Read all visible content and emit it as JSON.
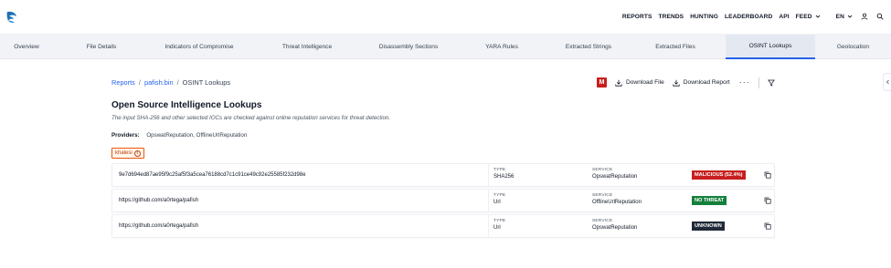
{
  "header": {
    "nav": [
      "REPORTS",
      "TRENDS",
      "HUNTING",
      "LEADERBOARD",
      "API",
      "FEED"
    ],
    "language": "EN"
  },
  "tabs": [
    {
      "label": "Overview"
    },
    {
      "label": "File Details"
    },
    {
      "label": "Indicators of Compromise"
    },
    {
      "label": "Threat Intelligence"
    },
    {
      "label": "Disassembly Sections"
    },
    {
      "label": "YARA Rules"
    },
    {
      "label": "Extracted Strings"
    },
    {
      "label": "Extracted Files"
    },
    {
      "label": "OSINT Lookups",
      "active": true
    },
    {
      "label": "Geolocation"
    }
  ],
  "breadcrumb": {
    "root": "Reports",
    "file": "pafish.bin",
    "current": "OSINT Lookups"
  },
  "actions": {
    "badge": "M",
    "download_file": "Download File",
    "download_report": "Download Report",
    "more": "···"
  },
  "page": {
    "title": "Open Source Intelligence Lookups",
    "subtitle": "The input SHA-256 and other selected IOCs are checked against online reputation services for threat detection.",
    "providers_label": "Providers:",
    "providers_value": "OpswatReputation, OfflineUrlReputation",
    "tag": "khalesi",
    "tag_info": "i"
  },
  "results": {
    "type_label": "TYPE",
    "service_label": "SERVICE",
    "rows": [
      {
        "value": "9e7d694ed87ae95f9c25af5f3a5cea76188cd7c1c91ce49c92e25585f232d98e",
        "type": "SHA256",
        "service": "OpswatReputation",
        "verdict": "MALICIOUS (52.4%)",
        "verdict_color": "#c81e1e"
      },
      {
        "value": "https://github.com/a0rtega/pafish",
        "type": "Url",
        "service": "OfflineUrlReputation",
        "verdict": "NO THREAT",
        "verdict_color": "#15803d"
      },
      {
        "value": "https://github.com/a0rtega/pafish",
        "type": "Url",
        "service": "OpswatReputation",
        "verdict": "UNKNOWN",
        "verdict_color": "#1f2937"
      }
    ]
  },
  "icons": {
    "logo": "wave-logo-icon",
    "user": "user-icon",
    "search": "search-icon",
    "download": "download-icon",
    "filter": "filter-icon",
    "copy": "copy-icon"
  },
  "colors": {
    "accent": "#2563eb",
    "tag": "#ea580c"
  }
}
